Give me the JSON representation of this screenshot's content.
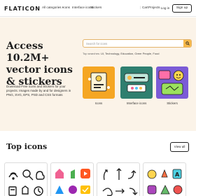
{
  "nav": {
    "logo_text": "FLATICON",
    "links": [
      "All categories",
      "Icons",
      "Interface icons",
      "Stickers"
    ],
    "right_links": [
      "Cart",
      "Projects"
    ],
    "login": "Log in",
    "signup": "Sign up"
  },
  "hero": {
    "title": "Access 10.2M+ vector icons & stickers",
    "subtitle": "Download Free icons and Stickers for your projects. Images made by and for designers in PNG, SVG, EPS, PSD and CSS formats",
    "search_placeholder": "Search for icons",
    "popular_label": "Top searches:",
    "popular_terms": "UI, Technology, Education, Greer People, Food",
    "cards": [
      {
        "label": "Icons",
        "bg": "#f5a623"
      },
      {
        "label": "Interface icons",
        "bg": "#2f7f6f"
      },
      {
        "label": "Stickers",
        "bg": "#7b5bd6"
      }
    ]
  },
  "top_icons": {
    "title": "Top icons",
    "view_all": "View all",
    "tiles": [
      "line-icons",
      "color-icons",
      "arrow-icons",
      "sticker-icons"
    ]
  },
  "colors": {
    "accent": "#f7b94a",
    "hero_bg": "#fbf3e8"
  }
}
